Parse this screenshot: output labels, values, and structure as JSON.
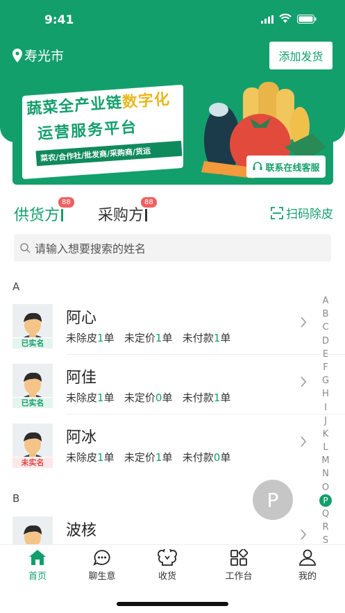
{
  "status": {
    "time": "9:41"
  },
  "header": {
    "location": "寿光市",
    "add_button": "添加发货"
  },
  "banner": {
    "title_a": "蔬菜全产业链",
    "title_b": "数字化",
    "line2": "运营服务平台",
    "strip": "菜农/合作社/批发商/采购商/货运",
    "service_button": "联系在线客服"
  },
  "tabs": [
    {
      "label": "供货方",
      "badge": "88"
    },
    {
      "label": "采购方",
      "badge": "88"
    }
  ],
  "scan_label": "扫码除皮",
  "search": {
    "placeholder": "请输入想要搜索的姓名"
  },
  "sections": [
    {
      "letter": "A",
      "contacts": [
        {
          "name": "阿心",
          "status": "已实名",
          "verified": true,
          "label_a": "未除皮",
          "count_a": "1",
          "label_b": "未定价",
          "count_b": "1",
          "label_c": "未付款",
          "count_c": "1",
          "unit": "单"
        },
        {
          "name": "阿佳",
          "status": "已实名",
          "verified": true,
          "label_a": "未除皮",
          "count_a": "1",
          "label_b": "未定价",
          "count_b": "0",
          "label_c": "未付款",
          "count_c": "1",
          "unit": "单"
        },
        {
          "name": "阿冰",
          "status": "未实名",
          "verified": false,
          "label_a": "未除皮",
          "count_a": "1",
          "label_b": "未定价",
          "count_b": "1",
          "label_c": "未付款",
          "count_c": "0",
          "unit": "单"
        }
      ]
    },
    {
      "letter": "B",
      "contacts": [
        {
          "name": "波核"
        }
      ]
    }
  ],
  "alphabet": [
    "A",
    "B",
    "C",
    "D",
    "E",
    "F",
    "G",
    "H",
    "I",
    "J",
    "K",
    "L",
    "M",
    "N",
    "O",
    "P",
    "Q",
    "R",
    "S"
  ],
  "alphabet_active": "P",
  "index_bubble": "P",
  "tabbar": [
    {
      "label": "首页",
      "icon": "home-icon",
      "active": true
    },
    {
      "label": "聊生意",
      "icon": "chat-icon"
    },
    {
      "label": "收货",
      "icon": "receive-icon"
    },
    {
      "label": "工作台",
      "icon": "workbench-icon"
    },
    {
      "label": "我的",
      "icon": "profile-icon"
    }
  ],
  "colors": {
    "brand": "#139f6c",
    "warn": "#e04848",
    "badge": "#f06060"
  }
}
